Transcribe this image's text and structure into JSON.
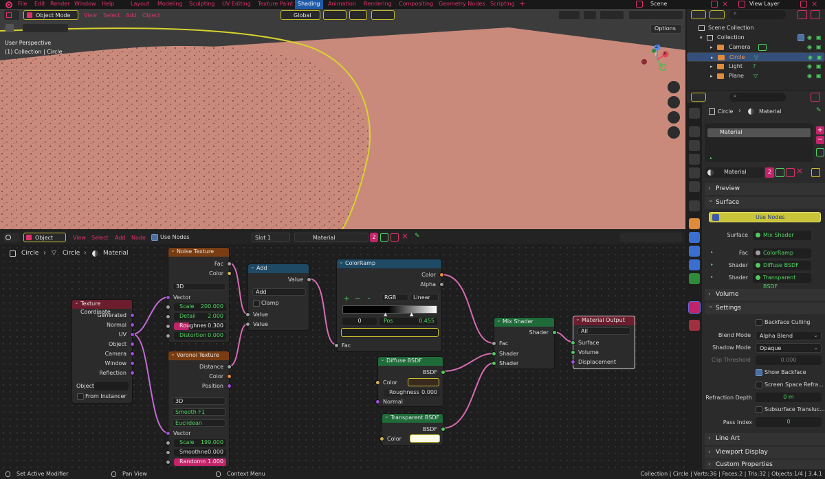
{
  "topbar": {
    "menus": [
      "File",
      "Edit",
      "Render",
      "Window",
      "Help"
    ],
    "workspaces": [
      "Layout",
      "Modeling",
      "Sculpting",
      "UV Editing",
      "Texture Paint",
      "Shading",
      "Animation",
      "Rendering",
      "Compositing",
      "Geometry Nodes",
      "Scripting"
    ],
    "active_workspace": "Shading",
    "scene": "Scene",
    "view_layer": "View Layer"
  },
  "viewport": {
    "mode": "Object Mode",
    "menus": [
      "View",
      "Select",
      "Add",
      "Object"
    ],
    "orientation": "Global",
    "options_label": "Options",
    "perspective_label": "User Perspective",
    "collection_label": "(1) Collection | Circle",
    "axes": [
      "X",
      "Y",
      "Z"
    ]
  },
  "node_editor": {
    "type": "Object",
    "menus": [
      "View",
      "Select",
      "Add",
      "Node"
    ],
    "use_nodes_label": "Use Nodes",
    "slot": "Slot 1",
    "material": "Material",
    "user_count": "2",
    "breadcrumb": [
      "Circle",
      "Circle",
      "Material"
    ],
    "nodes": {
      "texcoord": {
        "title": "Texture Coordinate",
        "outputs": [
          "Generated",
          "Normal",
          "UV",
          "Object",
          "Camera",
          "Window",
          "Reflection"
        ],
        "object_label": "Object:",
        "from_instancer": "From Instancer"
      },
      "noise": {
        "title": "Noise Texture",
        "outputs": [
          "Fac",
          "Color"
        ],
        "dimensions": "3D",
        "vector": "Vector",
        "scale_label": "Scale",
        "scale": "200.000",
        "detail_label": "Detail",
        "detail": "2.000",
        "roughness_label": "Roughnes",
        "roughness": "0.300",
        "distortion_label": "Distortion",
        "distortion": "0.000"
      },
      "voronoi": {
        "title": "Voronoi Texture",
        "outputs": [
          "Distance",
          "Color",
          "Position"
        ],
        "dimensions": "3D",
        "feature": "Smooth F1",
        "metric": "Euclidean",
        "vector": "Vector",
        "scale_label": "Scale",
        "scale": "199.000",
        "smoothness_label": "Smoothne",
        "smoothness": "0.000",
        "randomness_label": "Randomn",
        "randomness": "1.000"
      },
      "add": {
        "title": "Add",
        "output": "Value",
        "operation": "Add",
        "clamp": "Clamp",
        "inputs": [
          "Value",
          "Value"
        ]
      },
      "colorramp": {
        "title": "ColorRamp",
        "outputs": [
          "Color",
          "Alpha"
        ],
        "mode": "RGB",
        "interpolation": "Linear",
        "stop_index": "0",
        "pos_label": "Pos",
        "pos": "0.455",
        "input": "Fac"
      },
      "diffuse": {
        "title": "Diffuse BSDF",
        "output": "BSDF",
        "color_label": "Color",
        "roughness_label": "Roughness",
        "roughness": "0.000",
        "normal_label": "Normal"
      },
      "transparent": {
        "title": "Transparent BSDF",
        "output": "BSDF",
        "color_label": "Color"
      },
      "mix": {
        "title": "Mix Shader",
        "output": "Shader",
        "inputs": [
          "Fac",
          "Shader",
          "Shader"
        ]
      },
      "output": {
        "title": "Material Output",
        "target": "All",
        "inputs": [
          "Surface",
          "Volume",
          "Displacement"
        ]
      }
    }
  },
  "outliner": {
    "root": "Scene Collection",
    "collection": "Collection",
    "items": [
      {
        "name": "Camera",
        "selected": false
      },
      {
        "name": "Circle",
        "selected": true
      },
      {
        "name": "Light",
        "selected": false
      },
      {
        "name": "Plane",
        "selected": false
      }
    ]
  },
  "properties": {
    "breadcrumb_object": "Circle",
    "breadcrumb_material": "Material",
    "slot_name": "Material",
    "material_name": "Material",
    "user_count": "2",
    "panels": {
      "preview": "Preview",
      "surface": "Surface",
      "volume": "Volume",
      "settings": "Settings",
      "line_art": "Line Art",
      "viewport_display": "Viewport Display",
      "custom_properties": "Custom Properties"
    },
    "use_nodes": "Use Nodes",
    "surface_label": "Surface",
    "surface_value": "Mix Shader",
    "fac_label": "Fac",
    "fac_value": "ColorRamp",
    "shader1_label": "Shader",
    "shader1_value": "Diffuse BSDF",
    "shader2_label": "Shader",
    "shader2_value": "Transparent BSDF",
    "backface_culling": "Backface Culling",
    "blend_mode_label": "Blend Mode",
    "blend_mode": "Alpha Blend",
    "shadow_mode_label": "Shadow Mode",
    "shadow_mode": "Opaque",
    "clip_threshold_label": "Clip Threshold",
    "clip_threshold": "0.000",
    "show_backface": "Show Backface",
    "screen_space_refraction": "Screen Space Refra...",
    "refraction_depth_label": "Refraction Depth",
    "refraction_depth": "0 m",
    "subsurface": "Subsurface Transluc...",
    "pass_index_label": "Pass Index",
    "pass_index": "0"
  },
  "statusbar": {
    "left1": "Set Active Modifier",
    "left2": "Pan View",
    "left3": "Context Menu",
    "right": "Collection | Circle | Verts:36 | Faces:2 | Tris:32 | Objects:1/4 | 3.4.1"
  },
  "colors": {
    "accent_pink": "#e0306a",
    "active_blue": "#1f5aa8",
    "plane": "#c98a7c",
    "selection_yellow": "#d8d22e"
  }
}
